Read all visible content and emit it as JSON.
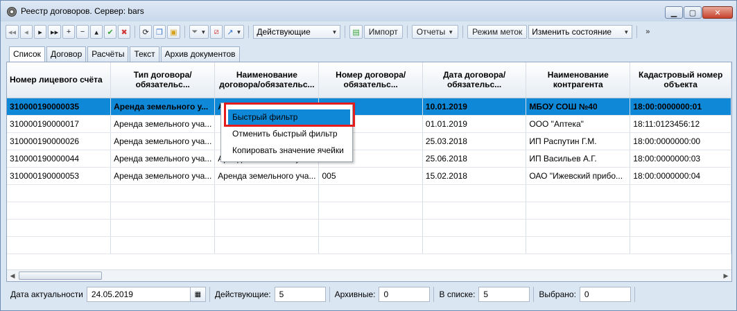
{
  "window": {
    "title": "Реестр договоров. Сервер: bars"
  },
  "toolbar": {
    "filter_combo": "Действующие",
    "import_label": "Импорт",
    "reports_label": "Отчеты",
    "marks_mode_label": "Режим меток",
    "change_state_label": "Изменить состояние",
    "overflow": "»"
  },
  "tabs": [
    "Список",
    "Договор",
    "Расчёты",
    "Текст",
    "Архив документов"
  ],
  "grid": {
    "columns": [
      "Номер лицевого счёта",
      "Тип договора/обязательс...",
      "Наименование договора/обязательс...",
      "Номер договора/обязательс...",
      "Дата договора/обязательс...",
      "Наименование контрагента",
      "Кадастровый номер объекта"
    ],
    "rows": [
      [
        "310000190000035",
        "Аренда земельного у...",
        "Ар",
        "",
        "10.01.2019",
        "МБОУ СОШ №40",
        "18:00:0000000:01"
      ],
      [
        "310000190000017",
        "Аренда земельного уча...",
        "",
        "",
        "01.01.2019",
        "ООО \"Аптека\"",
        "18:11:0123456:12"
      ],
      [
        "310000190000026",
        "Аренда земельного уча...",
        "",
        "",
        "25.03.2018",
        "ИП Распутин Г.М.",
        "18:00:0000000:00"
      ],
      [
        "310000190000044",
        "Аренда земельного уча...",
        "Аренда земельного уча...",
        "004",
        "25.06.2018",
        "ИП Васильев А.Г.",
        "18:00:0000000:03"
      ],
      [
        "310000190000053",
        "Аренда земельного уча...",
        "Аренда земельного уча...",
        "005",
        "15.02.2018",
        "ОАО \"Ижевский прибо...",
        "18:00:0000000:04"
      ]
    ]
  },
  "context_menu": {
    "items": [
      "Быстрый фильтр",
      "Отменить быстрый фильтр",
      "Копировать значение ячейки"
    ]
  },
  "statusbar": {
    "date_label": "Дата актуальности",
    "date_value": "24.05.2019",
    "active_label": "Действующие:",
    "active_value": "5",
    "archive_label": "Архивные:",
    "archive_value": "0",
    "in_list_label": "В списке:",
    "in_list_value": "5",
    "selected_label": "Выбрано:",
    "selected_value": "0"
  },
  "colors": {
    "selection": "#0f88d8",
    "highlight_border": "#e41c1c"
  }
}
